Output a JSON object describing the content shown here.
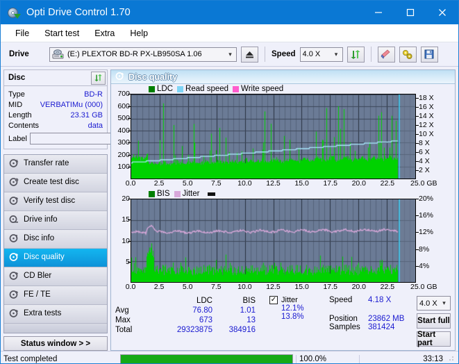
{
  "window": {
    "title": "Opti Drive Control 1.70",
    "minimize": "minimize",
    "maximize": "maximize",
    "close": "close"
  },
  "menu": [
    "File",
    "Start test",
    "Extra",
    "Help"
  ],
  "toolbar": {
    "drive_label": "Drive",
    "drive_value": "(E:)   PLEXTOR BD-R  PX-LB950SA 1.06",
    "eject_icon": "eject-icon",
    "speed_label": "Speed",
    "speed_value": "4.0 X",
    "refresh_icon": "refresh-icon",
    "erase_icon": "eraser-icon",
    "tools_icon": "tools-icon",
    "save_icon": "save-icon"
  },
  "disc": {
    "header": "Disc",
    "refresh_icon": "refresh-icon",
    "rows": [
      {
        "key": "Type",
        "value": "BD-R"
      },
      {
        "key": "MID",
        "value": "VERBATIMu (000)"
      },
      {
        "key": "Length",
        "value": "23.31 GB"
      },
      {
        "key": "Contents",
        "value": "data"
      }
    ],
    "label_key": "Label",
    "label_value": "",
    "label_button_icon": "disc-icon"
  },
  "nav": {
    "items": [
      {
        "label": "Transfer rate",
        "icon": "disc-test-icon",
        "selected": false
      },
      {
        "label": "Create test disc",
        "icon": "disc-burn-icon",
        "selected": false
      },
      {
        "label": "Verify test disc",
        "icon": "disc-verify-icon",
        "selected": false
      },
      {
        "label": "Drive info",
        "icon": "drive-info-icon",
        "selected": false
      },
      {
        "label": "Disc info",
        "icon": "disc-info-icon",
        "selected": false
      },
      {
        "label": "Disc quality",
        "icon": "disc-quality-icon",
        "selected": true
      },
      {
        "label": "CD Bler",
        "icon": "cd-bler-icon",
        "selected": false
      },
      {
        "label": "FE / TE",
        "icon": "fe-te-icon",
        "selected": false
      },
      {
        "label": "Extra tests",
        "icon": "extra-tests-icon",
        "selected": false
      }
    ],
    "status_window": "Status window > >"
  },
  "panel": {
    "title": "Disc quality",
    "title_icon": "disc-quality-icon"
  },
  "chart_data": [
    {
      "type": "line",
      "name": "ldc-chart",
      "title": "",
      "xlabel": "GB",
      "ylabel": "",
      "legend": [
        {
          "label": "LDC",
          "color": "#00b400"
        },
        {
          "label": "Read speed",
          "color": "#7fd4f5"
        },
        {
          "label": "Write speed",
          "color": "#ff5ccd"
        }
      ],
      "x": [
        0.0,
        2.5,
        5.0,
        7.5,
        10.0,
        12.5,
        15.0,
        17.5,
        20.0,
        22.5,
        25.0
      ],
      "xticks": [
        "0.0",
        "2.5",
        "5.0",
        "7.5",
        "10.0",
        "12.5",
        "15.0",
        "17.5",
        "20.0",
        "22.5"
      ],
      "xend_label": "25.0 GB",
      "xlim": [
        0,
        25.0
      ],
      "yticks_left": [
        "100",
        "200",
        "300",
        "400",
        "500",
        "600",
        "700"
      ],
      "ylim_left": [
        0,
        700
      ],
      "yticks_right": [
        "2 X",
        "4 X",
        "6 X",
        "8 X",
        "10 X",
        "12 X",
        "14 X",
        "16 X",
        "18 X"
      ],
      "ylim_right": [
        0,
        19
      ],
      "grid": true,
      "series": [
        {
          "name": "LDC",
          "color": "#00d200",
          "baseline_avg": 76.8,
          "peak_max": 673
        },
        {
          "name": "Read speed",
          "color": "#8fdcf8",
          "start": 3.6,
          "end": 8.3
        }
      ]
    },
    {
      "type": "line",
      "name": "bis-jitter-chart",
      "title": "",
      "xlabel": "GB",
      "legend": [
        {
          "label": "BIS",
          "color": "#00b400"
        },
        {
          "label": "Jitter",
          "color": "#d9a8da"
        }
      ],
      "xticks": [
        "0.0",
        "2.5",
        "5.0",
        "7.5",
        "10.0",
        "12.5",
        "15.0",
        "17.5",
        "20.0",
        "22.5"
      ],
      "xend_label": "25.0 GB",
      "xlim": [
        0,
        25.0
      ],
      "yticks_left": [
        "5",
        "10",
        "15",
        "20"
      ],
      "ylim_left": [
        0,
        20
      ],
      "yticks_right": [
        "4%",
        "8%",
        "12%",
        "16%",
        "20%"
      ],
      "ylim_right": [
        0,
        20
      ],
      "grid": true,
      "series": [
        {
          "name": "BIS",
          "color": "#00d200",
          "avg": 1.01,
          "max": 13
        },
        {
          "name": "Jitter",
          "color": "#d9a8da",
          "avg_pct": 12.1,
          "max_pct": 13.8
        }
      ]
    }
  ],
  "stats": {
    "col_ldc": "LDC",
    "col_bis": "BIS",
    "rows": [
      {
        "key": "Avg",
        "ldc": "76.80",
        "bis": "1.01"
      },
      {
        "key": "Max",
        "ldc": "673",
        "bis": "13"
      },
      {
        "key": "Total",
        "ldc": "29323875",
        "bis": "384916"
      }
    ],
    "jitter_label": "Jitter",
    "jitter_checked": "✓",
    "jitter_avg": "12.1%",
    "jitter_max": "13.8%",
    "speed_key": "Speed",
    "speed_value": "4.18 X",
    "position_key": "Position",
    "position_value": "23862 MB",
    "samples_key": "Samples",
    "samples_value": "381424",
    "speed_select": "4.0 X",
    "start_full": "Start full",
    "start_part": "Start part"
  },
  "statusbar": {
    "text": "Test completed",
    "percent_label": "100.0%",
    "percent": 100,
    "time": "33:13"
  },
  "colors": {
    "titlebar": "#0a78d4",
    "plot_bg": "#6b7b96",
    "ldc_green": "#00d200",
    "read_speed": "#8fdcf8",
    "jitter": "#d9a8da",
    "value_blue": "#1a1ad0",
    "selected_nav": "#0e92d8",
    "progress": "#16aa16"
  }
}
